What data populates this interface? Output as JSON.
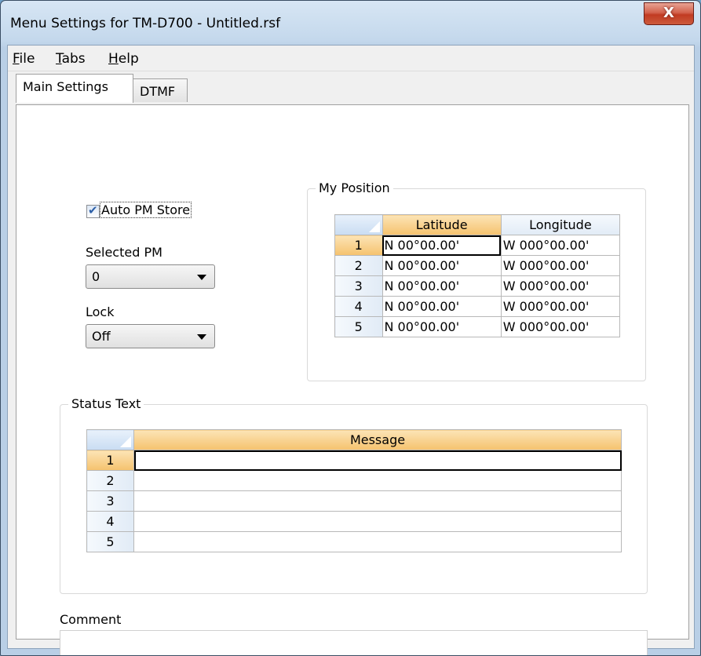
{
  "window": {
    "title": "Menu Settings for TM-D700 - Untitled.rsf",
    "close_glyph": "X"
  },
  "menu": [
    {
      "underlined": "F",
      "rest": "ile"
    },
    {
      "underlined": "T",
      "rest": "abs"
    },
    {
      "underlined": "H",
      "rest": "elp"
    }
  ],
  "tabs": [
    {
      "label": "Main Settings",
      "active": true
    },
    {
      "label": "DTMF",
      "active": false
    }
  ],
  "main": {
    "auto_pm_store": {
      "label": "Auto PM Store",
      "checked": true
    },
    "selected_pm": {
      "label": "Selected PM",
      "value": "0"
    },
    "lock": {
      "label": "Lock",
      "value": "Off"
    },
    "my_position": {
      "label": "My Position",
      "columns": [
        "Latitude",
        "Longitude"
      ],
      "rows": [
        {
          "num": "1",
          "lat": "N 00°00.00'",
          "lon": "W 000°00.00'"
        },
        {
          "num": "2",
          "lat": "N 00°00.00'",
          "lon": "W 000°00.00'"
        },
        {
          "num": "3",
          "lat": "N 00°00.00'",
          "lon": "W 000°00.00'"
        },
        {
          "num": "4",
          "lat": "N 00°00.00'",
          "lon": "W 000°00.00'"
        },
        {
          "num": "5",
          "lat": "N 00°00.00'",
          "lon": "W 000°00.00'"
        }
      ]
    },
    "status_text": {
      "label": "Status Text",
      "column": "Message",
      "rows": [
        {
          "num": "1",
          "message": ""
        },
        {
          "num": "2",
          "message": ""
        },
        {
          "num": "3",
          "message": ""
        },
        {
          "num": "4",
          "message": ""
        },
        {
          "num": "5",
          "message": ""
        }
      ]
    },
    "comment": {
      "label": "Comment",
      "value": ""
    }
  },
  "colors": {
    "header_selected": "#f5c26e",
    "header_normal": "#e1ebf6",
    "close_button": "#c13b22"
  }
}
